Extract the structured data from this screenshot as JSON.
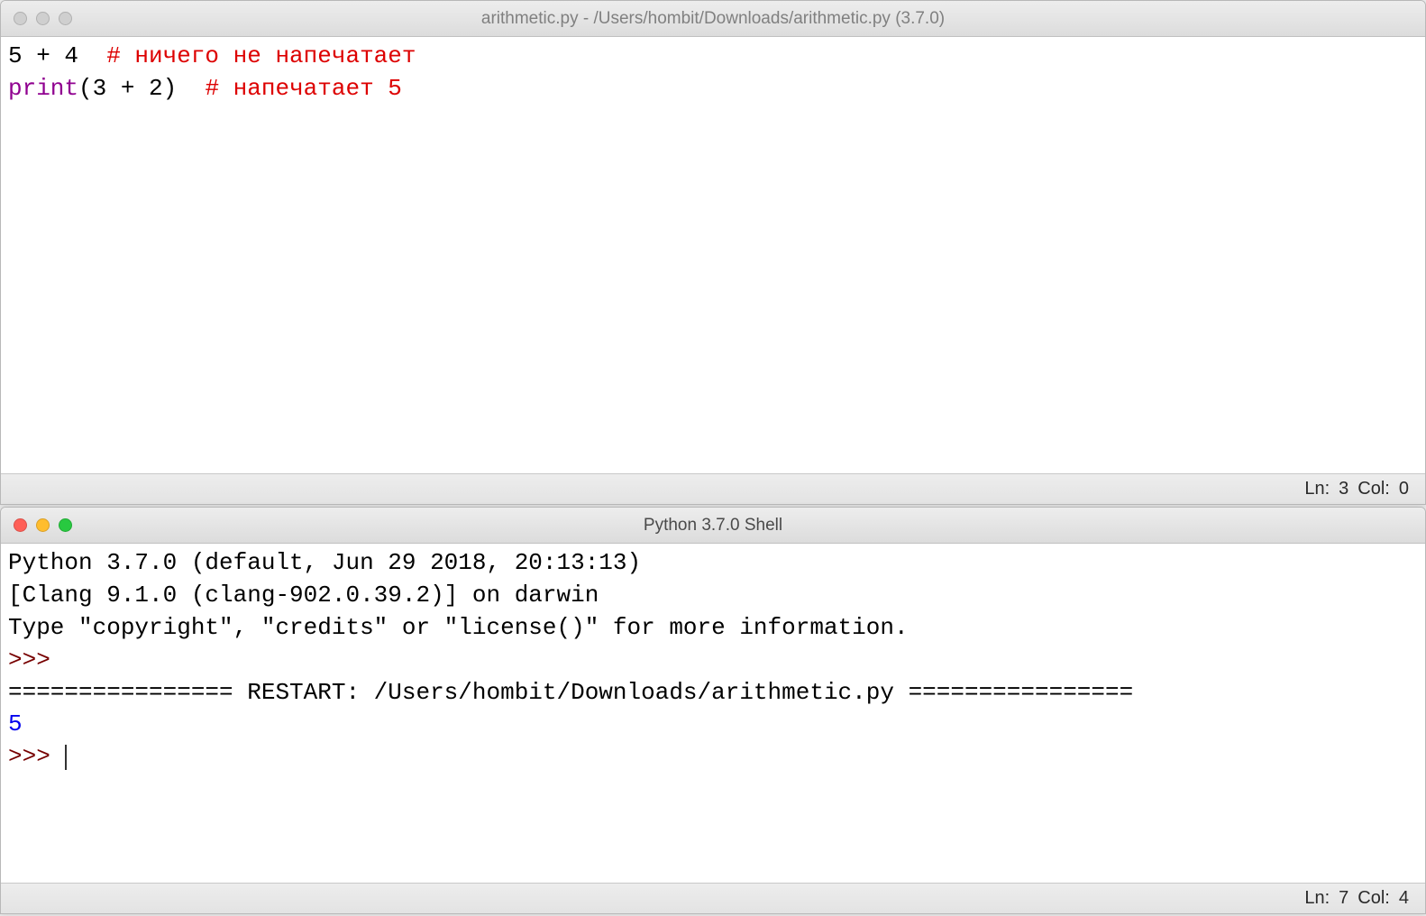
{
  "editor": {
    "title": "arithmetic.py - /Users/hombit/Downloads/arithmetic.py (3.7.0)",
    "traffic_active": false,
    "line1_code": "5 + 4  ",
    "line1_comment": "# ничего не напечатает",
    "line2_func": "print",
    "line2_args": "(3 + 2)  ",
    "line2_comment": "# напечатает 5",
    "status_ln_label": "Ln:",
    "status_ln": "3",
    "status_col_label": "Col:",
    "status_col": "0"
  },
  "shell": {
    "title": "Python 3.7.0 Shell",
    "traffic_active": true,
    "banner_line1": "Python 3.7.0 (default, Jun 29 2018, 20:13:13) ",
    "banner_line2": "[Clang 9.1.0 (clang-902.0.39.2)] on darwin",
    "banner_line3": "Type \"copyright\", \"credits\" or \"license()\" for more information.",
    "prompt1": ">>> ",
    "restart_line": "================ RESTART: /Users/hombit/Downloads/arithmetic.py ================",
    "output": "5",
    "prompt2": ">>> ",
    "status_ln_label": "Ln:",
    "status_ln": "7",
    "status_col_label": "Col:",
    "status_col": "4"
  }
}
